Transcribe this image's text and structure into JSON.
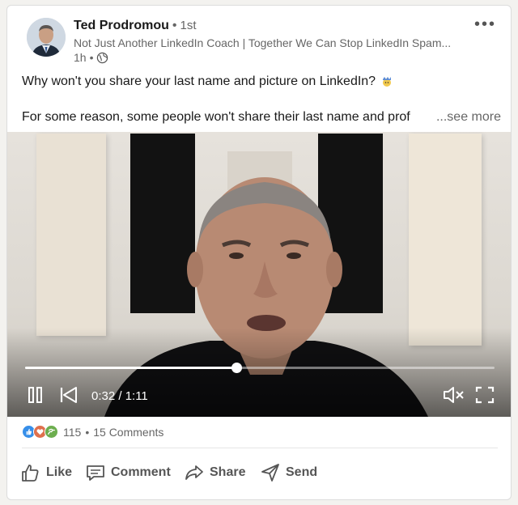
{
  "post": {
    "author": {
      "name": "Ted Prodromou",
      "degree": "1st",
      "headline": "Not Just Another LinkedIn Coach | Together We Can Stop LinkedIn Spam...",
      "time": "1h",
      "avatar_icon": "profile-photo",
      "visibility_icon": "globe-icon"
    },
    "more_icon": "ellipsis-icon",
    "text": {
      "line1": "Why won't you share your last name and picture on LinkedIn?",
      "line2": "For some reason, some people won't share their last name and prof",
      "see_more": "...see more"
    }
  },
  "video": {
    "current_time": "0:32",
    "duration": "1:11",
    "time_display": "0:32 / 1:11",
    "progress": 0.45,
    "controls": {
      "pause_icon": "pause-icon",
      "restart_icon": "skip-back-icon",
      "mute_icon": "volume-muted-icon",
      "fullscreen_icon": "fullscreen-icon"
    }
  },
  "social": {
    "reaction_icons": [
      "like-reaction-icon",
      "love-reaction-icon",
      "support-reaction-icon"
    ],
    "reaction_count": "115",
    "comments": "15 Comments"
  },
  "actions": [
    {
      "label": "Like",
      "icon": "thumbs-up-icon"
    },
    {
      "label": "Comment",
      "icon": "comment-icon"
    },
    {
      "label": "Share",
      "icon": "share-arrow-icon"
    },
    {
      "label": "Send",
      "icon": "send-icon"
    }
  ],
  "colors": {
    "like_blue": "#378fe9",
    "love_red": "#df704d",
    "support_green": "#6dae4f",
    "muted_text": "#666666"
  }
}
